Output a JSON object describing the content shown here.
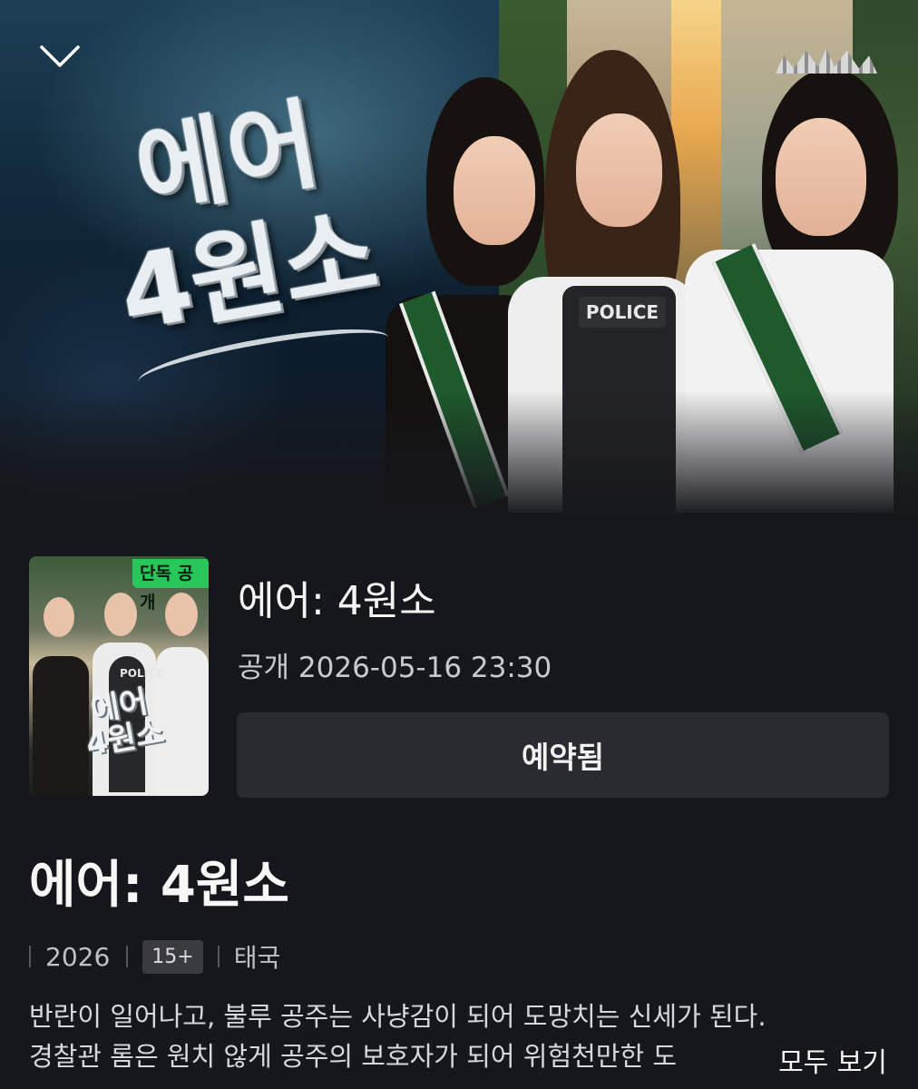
{
  "hero": {
    "logo_line1": "에어",
    "logo_line2": "4원소",
    "police_label": "POLICE"
  },
  "poster": {
    "badge": "단독 공개",
    "logo": "에어 4원소",
    "police_label": "POLICE",
    "badge_color": "#27c75a"
  },
  "show": {
    "title": "에어: 4원소",
    "release": "공개 2026-05-16 23:30",
    "reserve_label": "예약됨"
  },
  "details": {
    "title": "에어: 4원소",
    "year": "2026",
    "rating": "15+",
    "country": "태국",
    "description_line1": "반란이 일어나고, 불루 공주는 사냥감이 되어 도망치는 신세가 된다.",
    "description_line2": "경찰관 롬은 원치 않게 공주의 보호자가 되어 위험천만한 도",
    "more_label": "모두 보기"
  },
  "icons": {
    "collapse": "chevron-down-icon"
  },
  "colors": {
    "background": "#16171c",
    "button": "#2a2b30",
    "accent_green": "#27c75a"
  }
}
